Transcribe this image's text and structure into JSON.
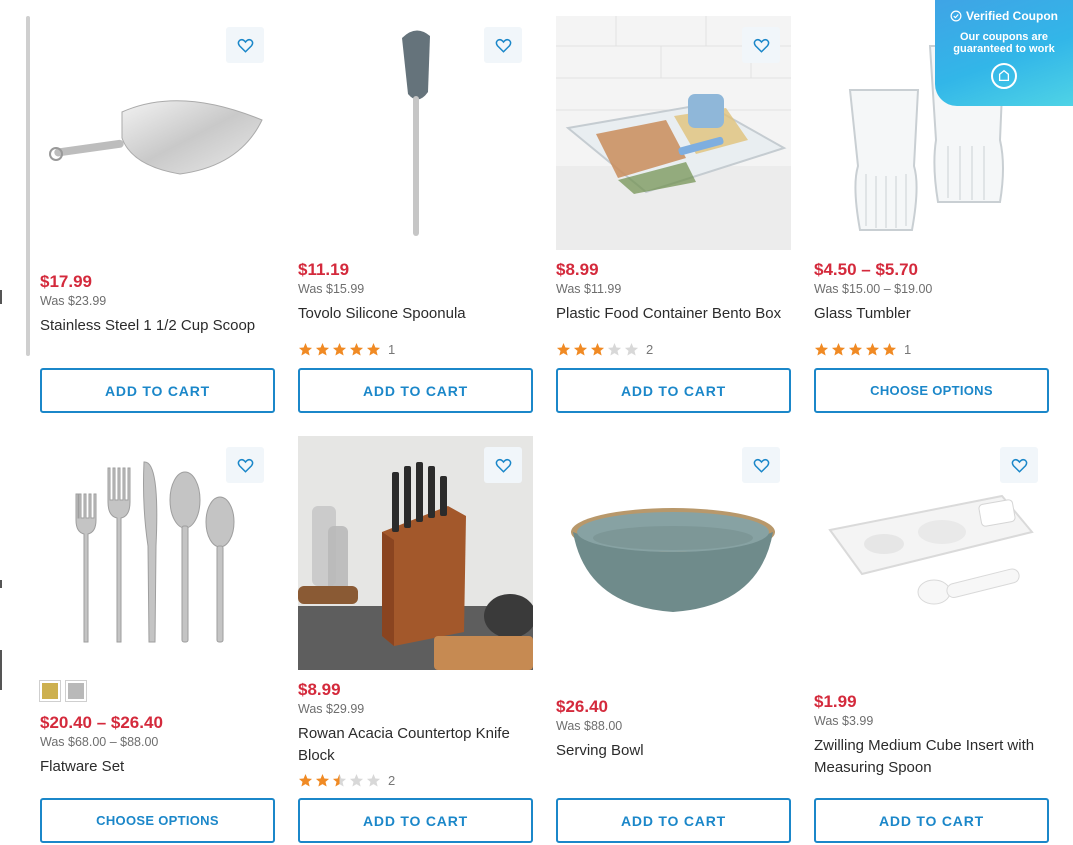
{
  "products": [
    {
      "price": "$17.99",
      "was": "Was $23.99",
      "title": "Stainless Steel 1 1/2 Cup Scoop",
      "button": "ADD TO CART"
    },
    {
      "price": "$11.19",
      "was": "Was $15.99",
      "title": "Tovolo Silicone Spoonula",
      "rating": 5,
      "review_count": "1",
      "button": "ADD TO CART"
    },
    {
      "price": "$8.99",
      "was": "Was $11.99",
      "title": "Plastic Food Container Bento Box",
      "rating": 3,
      "review_count": "2",
      "button": "ADD TO CART"
    },
    {
      "price": "$4.50 – $5.70",
      "was": "Was $15.00 – $19.00",
      "title": "Glass Tumbler",
      "rating": 5,
      "review_count": "1",
      "button": "CHOOSE OPTIONS"
    },
    {
      "price": "$20.40 – $26.40",
      "was": "Was $68.00 – $88.00",
      "title": "Flatware Set",
      "button": "CHOOSE OPTIONS",
      "swatches": [
        "#cdb04f",
        "#b9b9b9"
      ]
    },
    {
      "price": "$8.99",
      "was": "Was $29.99",
      "title": "Rowan Acacia Countertop Knife Block",
      "rating": 2.5,
      "review_count": "2",
      "button": "ADD TO CART"
    },
    {
      "price": "$26.40",
      "was": "Was $88.00",
      "title": "Serving Bowl",
      "button": "ADD TO CART"
    },
    {
      "price": "$1.99",
      "was": "Was $3.99",
      "title": "Zwilling Medium Cube Insert with Measuring Spoon",
      "button": "ADD TO CART"
    }
  ],
  "coupon": {
    "heading": "Verified Coupon",
    "line1": "Our coupons are",
    "line2": "guaranteed to work"
  },
  "colors": {
    "price": "#d42a3c",
    "accent": "#1b87c9",
    "star": "#f08a24",
    "star_empty": "#d8d8d8"
  },
  "icons": {
    "wishlist": "heart-icon",
    "rating": "star-icon",
    "coupon_check": "check-circle-icon",
    "coupon_badge": "tag-icon"
  }
}
